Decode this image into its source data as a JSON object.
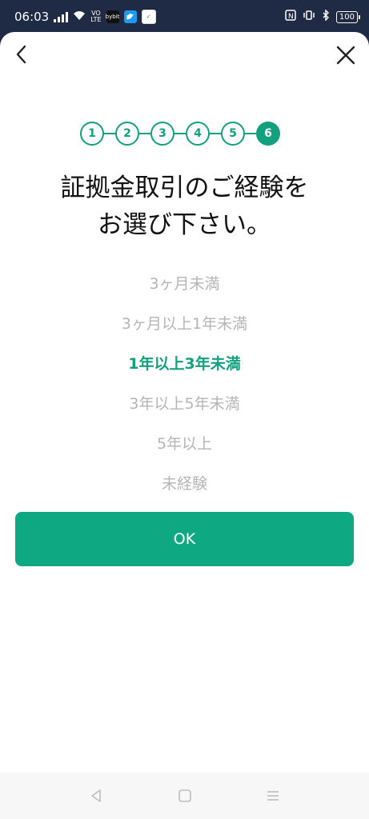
{
  "status_bar": {
    "time": "06:03",
    "network_label": "VO\nLTE",
    "battery": "100",
    "app_icons": [
      "bybit",
      "twitter",
      "watch"
    ]
  },
  "stepper": {
    "steps": [
      "1",
      "2",
      "3",
      "4",
      "5",
      "6"
    ],
    "active_index": 5
  },
  "title": {
    "line1": "証拠金取引のご経験を",
    "line2": "お選び下さい。"
  },
  "options": [
    "3ヶ月未満",
    "3ヶ月以上1年未満",
    "1年以上3年未満",
    "3年以上5年未満",
    "5年以上",
    "未経験"
  ],
  "selected_option_index": 2,
  "ok_button": {
    "label": "OK"
  },
  "colors": {
    "accent": "#0ea983",
    "muted": "#b5b5b5",
    "status_bar": "#1f2a44"
  }
}
